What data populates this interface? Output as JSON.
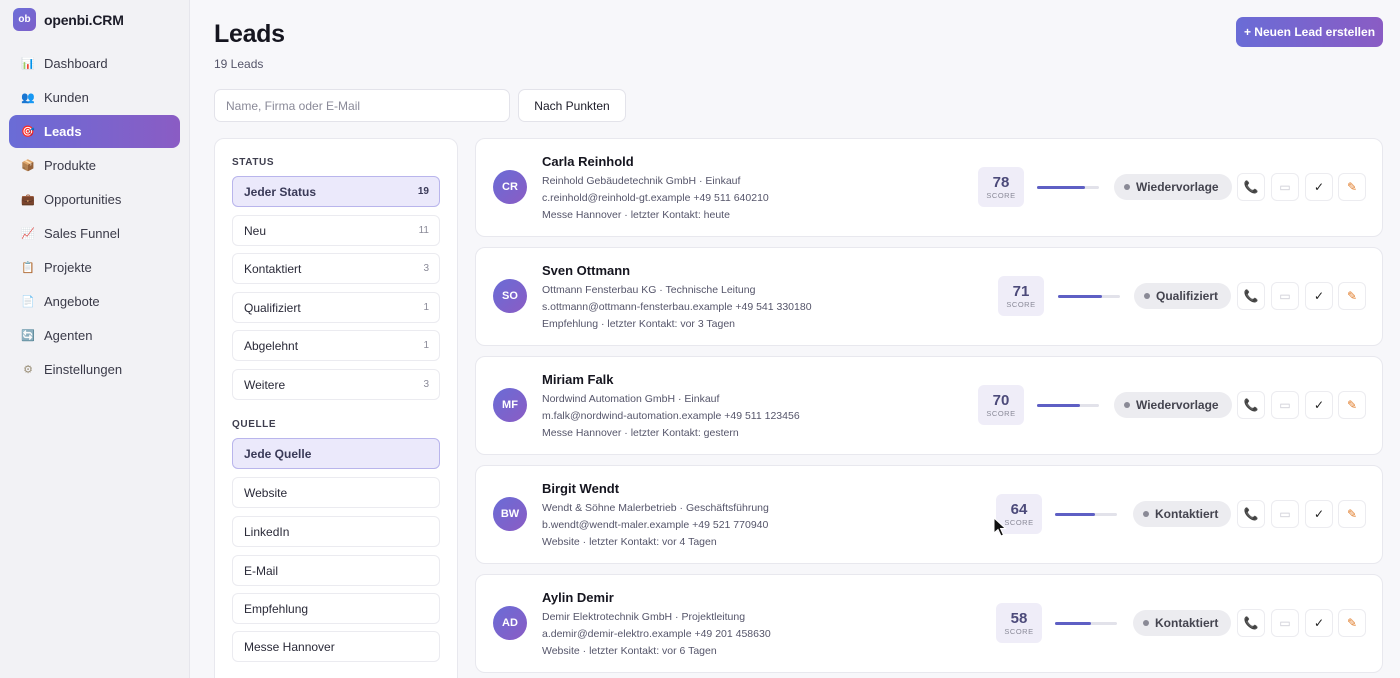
{
  "brand": {
    "logo": "ob",
    "name": "openbi.CRM"
  },
  "nav": [
    {
      "label": "Dashboard",
      "icon": "📊",
      "active": false
    },
    {
      "label": "Kunden",
      "icon": "👥",
      "active": false
    },
    {
      "label": "Leads",
      "icon": "🎯",
      "active": true
    },
    {
      "label": "Produkte",
      "icon": "📦",
      "active": false
    },
    {
      "label": "Opportunities",
      "icon": "💼",
      "active": false
    },
    {
      "label": "Sales Funnel",
      "icon": "📈",
      "active": false
    },
    {
      "label": "Projekte",
      "icon": "📋",
      "active": false
    },
    {
      "label": "Angebote",
      "icon": "📄",
      "active": false
    },
    {
      "label": "Agenten",
      "icon": "🔄",
      "active": false
    },
    {
      "label": "Einstellungen",
      "icon": "⚙",
      "active": false
    }
  ],
  "header": {
    "title": "Leads",
    "subtitle": "19 Leads",
    "new_button": "+ Neuen Lead erstellen",
    "search_placeholder": "Name, Firma oder E-Mail",
    "sort_button": "Nach Punkten"
  },
  "filters": {
    "status_heading": "STATUS",
    "status": [
      {
        "label": "Jeder Status",
        "count": "19",
        "selected": true
      },
      {
        "label": "Neu",
        "count": "11",
        "selected": false
      },
      {
        "label": "Kontaktiert",
        "count": "3",
        "selected": false
      },
      {
        "label": "Qualifiziert",
        "count": "1",
        "selected": false
      },
      {
        "label": "Abgelehnt",
        "count": "1",
        "selected": false
      },
      {
        "label": "Weitere",
        "count": "3",
        "selected": false
      }
    ],
    "source_heading": "QUELLE",
    "source": [
      {
        "label": "Jede Quelle",
        "selected": true
      },
      {
        "label": "Website",
        "selected": false
      },
      {
        "label": "LinkedIn",
        "selected": false
      },
      {
        "label": "E-Mail",
        "selected": false
      },
      {
        "label": "Empfehlung",
        "selected": false
      },
      {
        "label": "Messe Hannover",
        "selected": false
      }
    ]
  },
  "score_label": "SCORE",
  "leads": [
    {
      "initials": "CR",
      "name": "Carla Reinhold",
      "company": "Reinhold Gebäudetechnik GmbH · Einkauf",
      "contact": "c.reinhold@reinhold-gt.example +49 511 640210",
      "meta": "Messe Hannover · letzter Kontakt: heute",
      "score": "78",
      "score_pct": 78,
      "status": "Wiedervorlage"
    },
    {
      "initials": "SO",
      "name": "Sven Ottmann",
      "company": "Ottmann Fensterbau KG · Technische Leitung",
      "contact": "s.ottmann@ottmann-fensterbau.example +49 541 330180",
      "meta": "Empfehlung · letzter Kontakt: vor 3 Tagen",
      "score": "71",
      "score_pct": 71,
      "status": "Qualifiziert"
    },
    {
      "initials": "MF",
      "name": "Miriam Falk",
      "company": "Nordwind Automation GmbH · Einkauf",
      "contact": "m.falk@nordwind-automation.example +49 511 123456",
      "meta": "Messe Hannover · letzter Kontakt: gestern",
      "score": "70",
      "score_pct": 70,
      "status": "Wiedervorlage"
    },
    {
      "initials": "BW",
      "name": "Birgit Wendt",
      "company": "Wendt & Söhne Malerbetrieb · Geschäftsführung",
      "contact": "b.wendt@wendt-maler.example +49 521 770940",
      "meta": "Website · letzter Kontakt: vor 4 Tagen",
      "score": "64",
      "score_pct": 64,
      "status": "Kontaktiert"
    },
    {
      "initials": "AD",
      "name": "Aylin Demir",
      "company": "Demir Elektrotechnik GmbH · Projektleitung",
      "contact": "a.demir@demir-elektro.example +49 201 458630",
      "meta": "Website · letzter Kontakt: vor 6 Tagen",
      "score": "58",
      "score_pct": 58,
      "status": "Kontaktiert"
    }
  ],
  "actions": {
    "phone_icon": "📞",
    "mail_icon": "▭",
    "check_icon": "✓",
    "edit_icon": "✎"
  }
}
